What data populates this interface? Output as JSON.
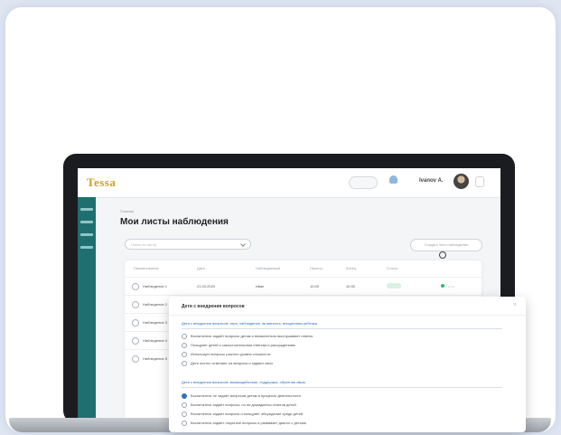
{
  "app": {
    "logo_text": "Tessa",
    "user_name": "Ivanov A.",
    "colors": {
      "sidebar": "#1f6f70",
      "accent": "#2e6fbf",
      "logo": "#c9a227"
    }
  },
  "page": {
    "breadcrumb": "Главная",
    "title": "Мои листы наблюдения",
    "filter_placeholder": "Поиск по листу",
    "create_button": "Создать лист наблюдения"
  },
  "table": {
    "headers": [
      "Наименование",
      "Дата",
      "Наблюдаемый",
      "Начало",
      "Конец",
      "Статус"
    ],
    "rows": [
      {
        "name": "Наблюдение 1",
        "date": "21.03.2023",
        "who": "Иван",
        "start": "10:00",
        "end": "10:30",
        "status": ""
      },
      {
        "name": "Наблюдение 2",
        "date": "",
        "who": "",
        "start": "",
        "end": "",
        "status": ""
      },
      {
        "name": "Наблюдение 3",
        "date": "",
        "who": "",
        "start": "",
        "end": "",
        "status": ""
      },
      {
        "name": "Наблюдение 4",
        "date": "",
        "who": "",
        "start": "",
        "end": "",
        "status": ""
      },
      {
        "name": "Наблюдение 5",
        "date": "",
        "who": "",
        "start": "",
        "end": "",
        "status": ""
      }
    ]
  },
  "modal": {
    "title": "Дети с внедрения вопросов",
    "section1": {
      "heading": "Дети с внедрения вопросов: игра, наблюдение, активность, инициатива ребенка",
      "options": [
        "Воспитатель задаёт вопросы детям и внимательно выслушивает ответы",
        "Поощряет детей к самостоятельным ответам и рассуждениям",
        "Использует вопросы разного уровня сложности",
        "Дети охотно отвечают на вопросы и задают свои"
      ]
    },
    "section2": {
      "heading": "Дети с внедрения вопросов: взаимодействие, поддержка, обратная связь",
      "options": [
        "Воспитатель не задаёт вопросов детям в процессе деятельности",
        "Воспитатель задаёт вопросы, но не дожидается ответов детей",
        "Воспитатель задаёт вопросы и поощряет обсуждение среди детей",
        "Воспитатель задаёт открытые вопросы и развивает диалог с детьми"
      ],
      "selected_index": 0
    }
  }
}
